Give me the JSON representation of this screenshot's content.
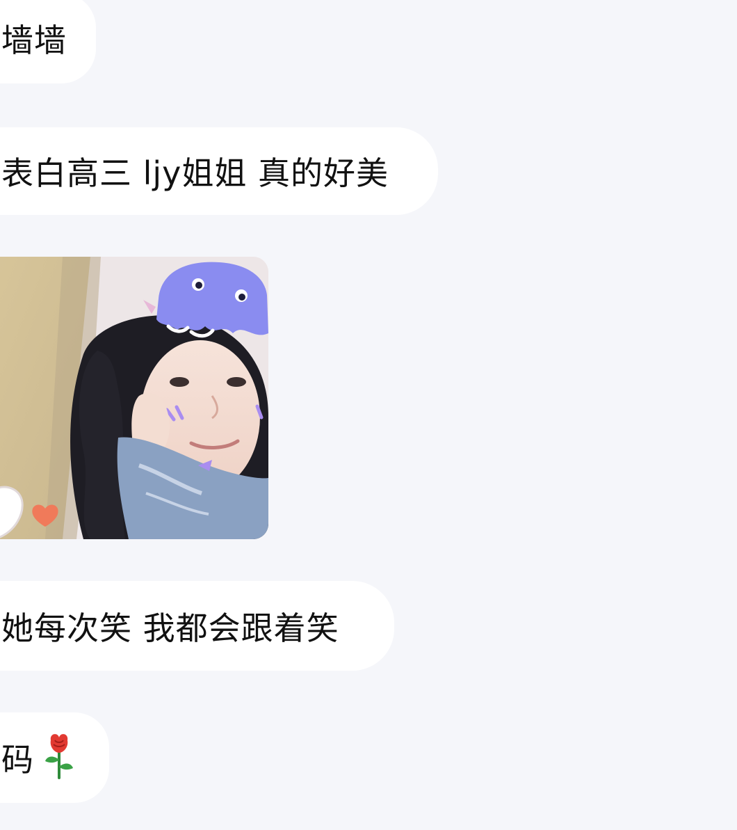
{
  "messages": [
    {
      "id": "msg1",
      "type": "text",
      "text": "墙墙"
    },
    {
      "id": "msg2",
      "type": "text",
      "text": "表白高三 ljy姐姐 真的好美"
    },
    {
      "id": "msg3",
      "type": "image",
      "icon": "photo-girl-with-dinosaur-sticker"
    },
    {
      "id": "msg4",
      "type": "text",
      "text": "她每次笑 我都会跟着笑"
    },
    {
      "id": "msg5",
      "type": "text",
      "text": "码",
      "emoji": "rose-icon"
    }
  ],
  "colors": {
    "background": "#f5f6fa",
    "bubble": "#ffffff",
    "text": "#111111",
    "sticker": "#8a8cf0"
  }
}
